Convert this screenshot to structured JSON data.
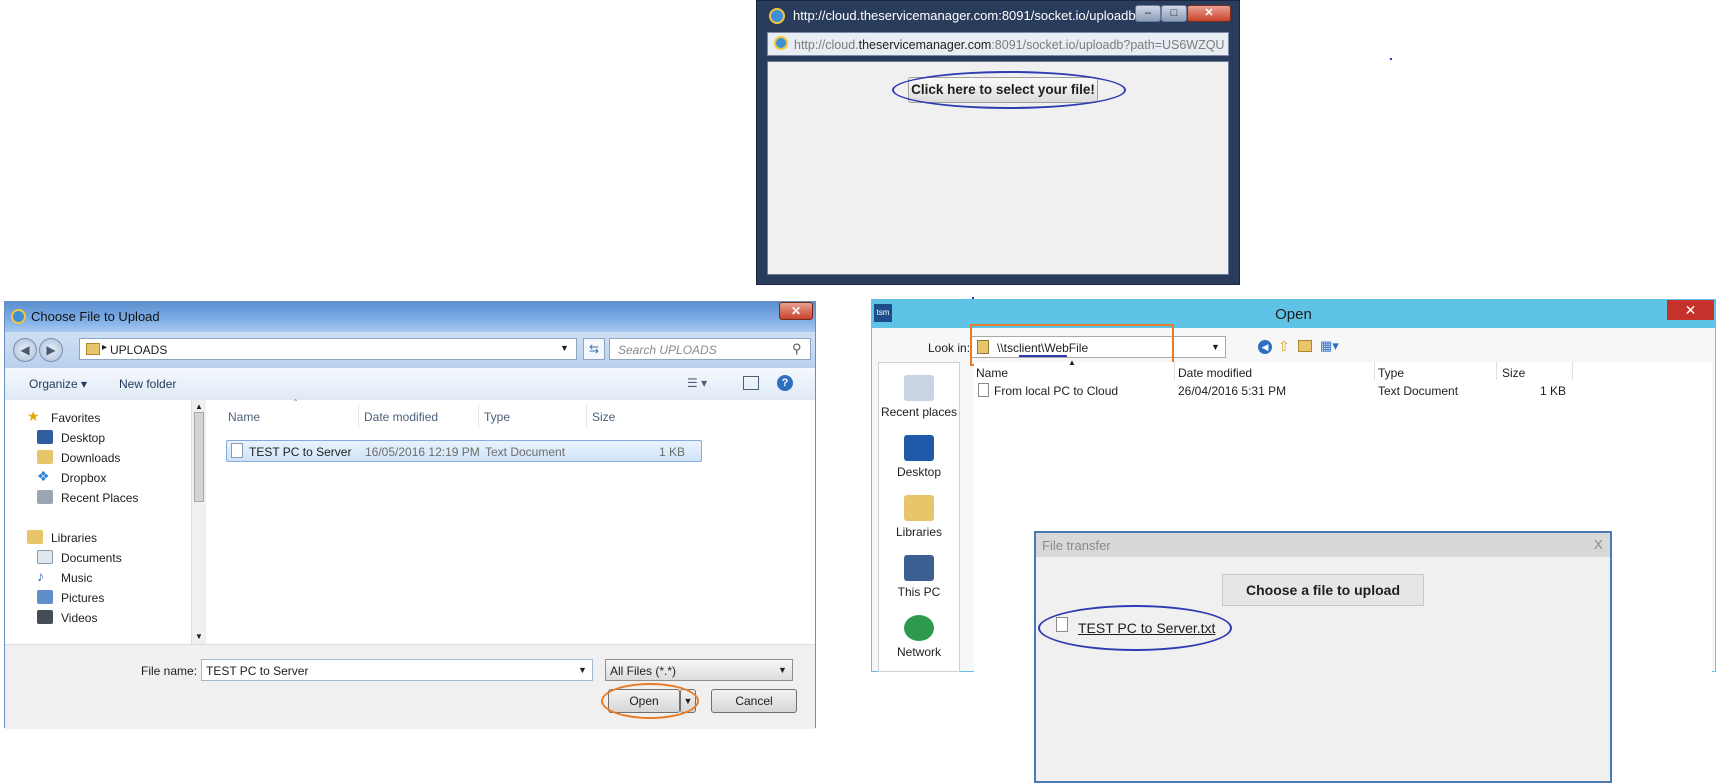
{
  "ie_popup": {
    "title": "http://cloud.theservicemanager.com:8091/socket.io/uploadb...",
    "address_pre": "http://cloud.",
    "address_domain": "theservicemanager.com",
    "address_post": ":8091/socket.io/uploadb?path=US6WZQUZ(",
    "select_button": "Click here to select your file!"
  },
  "choose_dialog": {
    "title": "Choose File to Upload",
    "path": "UPLOADS",
    "search_placeholder": "Search UPLOADS",
    "toolbar": {
      "organize": "Organize ▾",
      "new_folder": "New folder"
    },
    "nav": [
      {
        "label": "Favorites",
        "head": true
      },
      {
        "label": "Desktop"
      },
      {
        "label": "Downloads"
      },
      {
        "label": "Dropbox"
      },
      {
        "label": "Recent Places"
      },
      {
        "label": "Libraries",
        "head": true
      },
      {
        "label": "Documents"
      },
      {
        "label": "Music"
      },
      {
        "label": "Pictures"
      },
      {
        "label": "Videos"
      }
    ],
    "columns": [
      "Name",
      "Date modified",
      "Type",
      "Size"
    ],
    "row": {
      "name": "TEST PC to Server",
      "date": "16/05/2016 12:19 PM",
      "type": "Text Document",
      "size": "1 KB"
    },
    "file_name_label": "File name:",
    "file_name_value": "TEST PC to Server",
    "filter": "All Files (*.*)",
    "open": "Open",
    "cancel": "Cancel"
  },
  "open_dialog": {
    "app_badge": "tsm",
    "title": "Open",
    "look_in_label": "Look in:",
    "look_in_value": "\\\\tsclient\\WebFile",
    "places": [
      "Recent places",
      "Desktop",
      "Libraries",
      "This PC",
      "Network"
    ],
    "columns": [
      "Name",
      "Date modified",
      "Type",
      "Size"
    ],
    "row": {
      "name": "From local PC to Cloud",
      "date": "26/04/2016 5:31 PM",
      "type": "Text Document",
      "size": "1 KB"
    }
  },
  "file_transfer": {
    "title": "File transfer",
    "close": "X",
    "choose_button": "Choose a file to upload",
    "file_link": "TEST PC to Server.txt"
  },
  "colors": {
    "annotation_blue": "#2f3bb0",
    "annotation_orange": "#e87b25",
    "win8_accent": "#5fc3e6"
  }
}
